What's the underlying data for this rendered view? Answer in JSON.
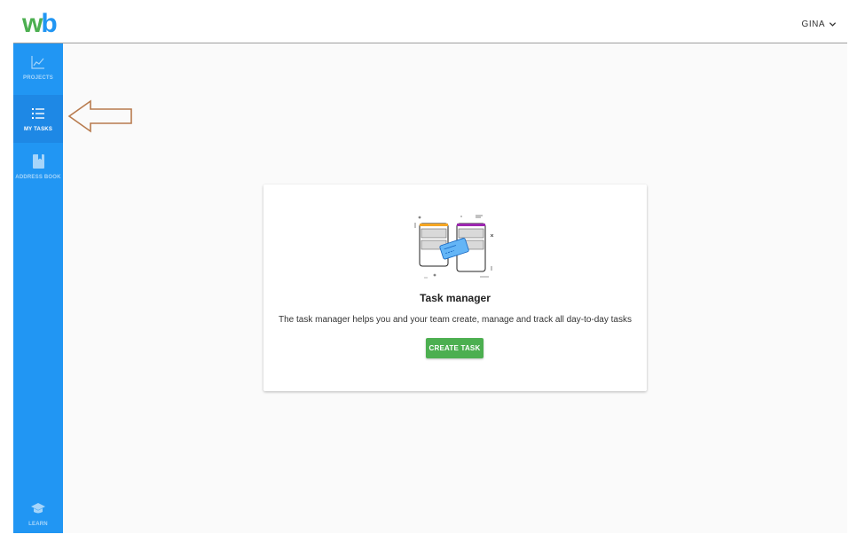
{
  "brand": {
    "logo_w": "w",
    "logo_b": "b",
    "green": "#4caf50",
    "blue": "#2196f3"
  },
  "header": {
    "user_name": "GINA",
    "user_menu_icon": "chevron-down-icon"
  },
  "sidebar": {
    "background": "#2196f3",
    "items": [
      {
        "id": "projects",
        "label": "PROJECTS",
        "icon": "chart-line-icon",
        "active": false
      },
      {
        "id": "my-tasks",
        "label": "MY TASKS",
        "icon": "list-icon",
        "active": true
      },
      {
        "id": "address-book",
        "label": "ADDRESS BOOK",
        "icon": "book-icon",
        "active": false
      }
    ],
    "footer_item": {
      "id": "learn",
      "label": "LEARN",
      "icon": "graduation-cap-icon"
    }
  },
  "empty_state": {
    "title": "Task manager",
    "description": "The task manager helps you and your team create, manage and track all day-to-day tasks",
    "button_label": "CREATE TASK",
    "illustration": "task-board-illustration"
  },
  "annotation": {
    "icon": "arrow-left-icon",
    "color": "#b87b4e"
  }
}
